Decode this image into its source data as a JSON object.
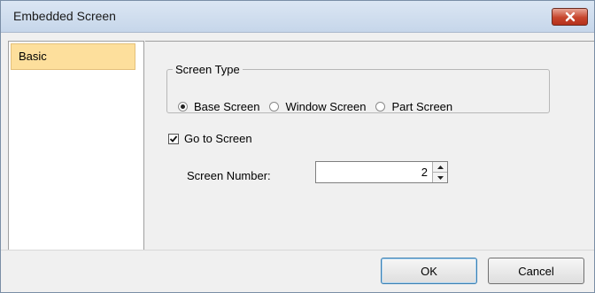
{
  "window": {
    "title": "Embedded Screen"
  },
  "sidebar": {
    "items": [
      {
        "label": "Basic",
        "selected": true
      }
    ]
  },
  "screen_type": {
    "legend": "Screen Type",
    "options": [
      {
        "label": "Base Screen",
        "selected": true
      },
      {
        "label": "Window Screen",
        "selected": false
      },
      {
        "label": "Part Screen",
        "selected": false
      }
    ]
  },
  "go_to_screen": {
    "label": "Go to Screen",
    "checked": true
  },
  "screen_number": {
    "label": "Screen Number:",
    "value": "2"
  },
  "footer": {
    "ok_label": "OK",
    "cancel_label": "Cancel"
  },
  "colors": {
    "selected_item_bg": "#fddf9c",
    "close_button": "#c7452c"
  }
}
